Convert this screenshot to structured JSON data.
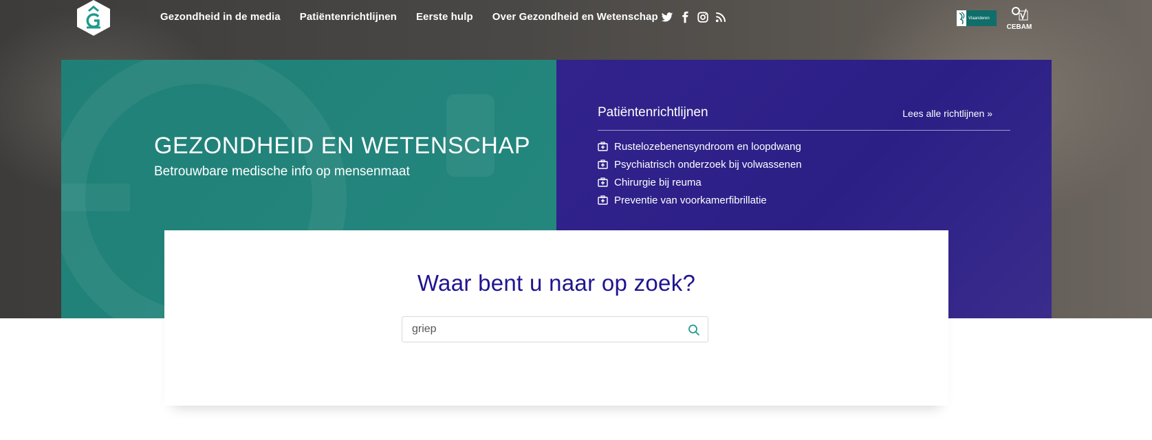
{
  "nav": {
    "items": [
      {
        "label": "Gezondheid in de media"
      },
      {
        "label": "Patiëntenrichtlijnen"
      },
      {
        "label": "Eerste hulp"
      },
      {
        "label": "Over Gezondheid en Wetenschap"
      }
    ]
  },
  "social": [
    "twitter-icon",
    "facebook-icon",
    "instagram-icon",
    "rss-icon"
  ],
  "partners": {
    "vlaanderen": "Vlaanderen",
    "cebam": "CEBAM"
  },
  "hero": {
    "title": "GEZONDHEID EN WETENSCHAP",
    "subtitle": "Betrouwbare medische info op mensenmaat"
  },
  "guidelines": {
    "title": "Patiëntenrichtlijnen",
    "all_link": "Lees alle richtlijnen »",
    "items": [
      {
        "label": "Rustelozebenensyndroom en loopdwang"
      },
      {
        "label": "Psychiatrisch onderzoek bij volwassenen"
      },
      {
        "label": "Chirurgie bij reuma"
      },
      {
        "label": "Preventie van voorkamerfibrillatie"
      }
    ]
  },
  "search": {
    "heading": "Waar bent u naar op zoek?",
    "value": "griep"
  },
  "colors": {
    "teal": "#1e827a",
    "purple": "#2b1f86",
    "heading_blue": "#1f1490"
  }
}
